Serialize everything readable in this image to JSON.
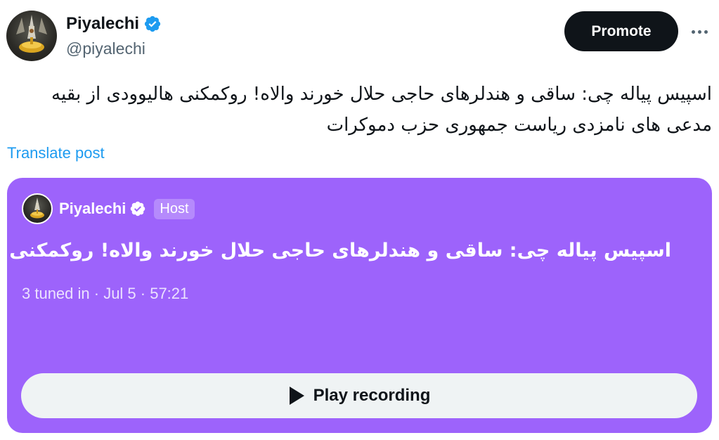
{
  "author": {
    "display_name": "Piyalechi",
    "handle": "@piyalechi",
    "verified": true
  },
  "actions": {
    "promote_label": "Promote",
    "more_icon": "ellipsis-icon"
  },
  "post": {
    "text": "اسپیس پیاله چی: ساقی و هندلرهای حاجی حلال خورند والاه! روکمکنی هالیوودی از بقیه مدعی های نامزدی ریاست جمهوری حزب دموکرات",
    "translate_label": "Translate post"
  },
  "space": {
    "host_name": "Piyalechi",
    "host_badge": "Host",
    "title": "اسپیس پیاله چی: ساقی و هندلرهای حاجی حلال خورند والاه! روکمکنی هالیوود",
    "meta": "3 tuned in · Jul 5 · 57:21",
    "play_label": "Play recording"
  },
  "colors": {
    "card_background": "#9d63fb",
    "verified_blue": "#1d9bf0",
    "promote_background": "#0f1419",
    "link": "#1d9bf0"
  }
}
